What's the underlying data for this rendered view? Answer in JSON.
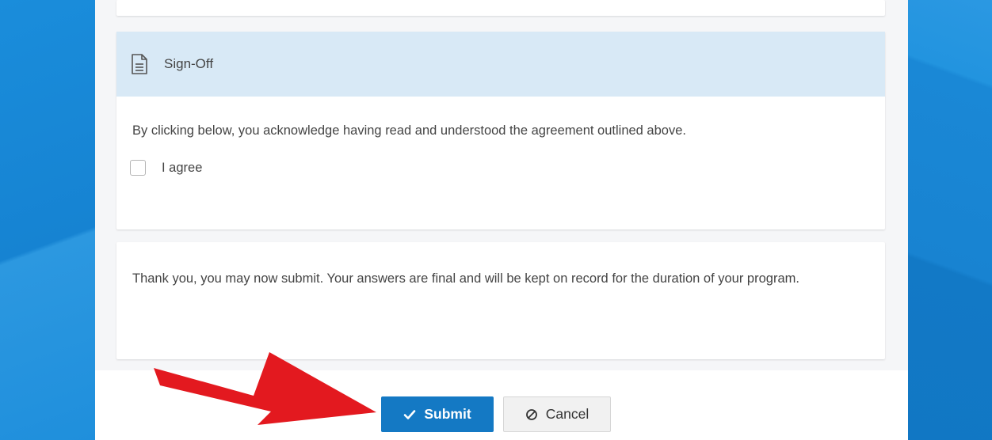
{
  "signoff": {
    "title": "Sign-Off",
    "acknowledgement": "By clicking below, you acknowledge having read and understood the agreement outlined above.",
    "agree_label": "I agree",
    "agree_checked": false
  },
  "notice": {
    "text": "Thank you, you may now submit. Your answers are final and will be kept on record for the duration of your program."
  },
  "actions": {
    "submit_label": "Submit",
    "cancel_label": "Cancel"
  },
  "annotation": {
    "arrow_color": "#e3191f"
  },
  "colors": {
    "background": "#1486d4",
    "header_tint": "#d8e9f6",
    "primary": "#1479c4"
  },
  "icons": {
    "sign_off": "document-icon",
    "submit": "checkmark-icon",
    "cancel": "prohibited-icon"
  }
}
